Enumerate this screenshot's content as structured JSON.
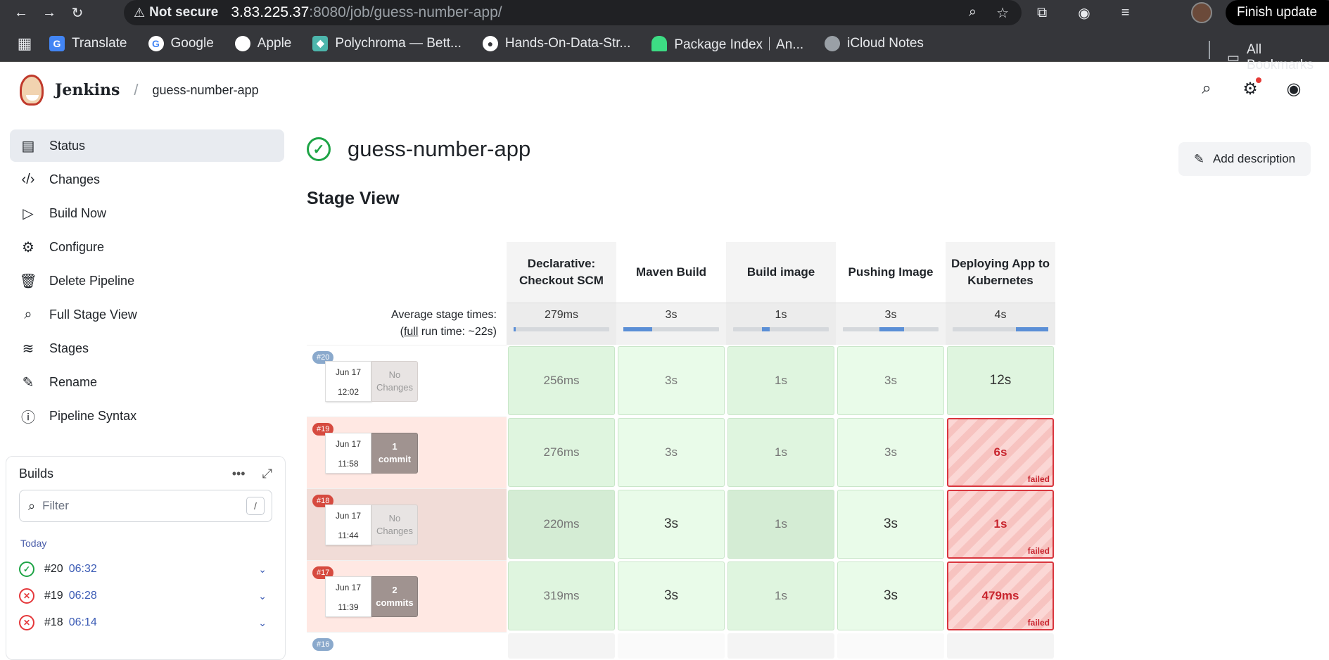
{
  "browser": {
    "security": "Not secure",
    "url_host": "3.83.225.37",
    "url_path": ":8080/job/guess-number-app/",
    "finish_update": "Finish update",
    "all_bookmarks": "All Bookmarks",
    "bookmarks": [
      {
        "label": "Translate",
        "color": "#4285f4"
      },
      {
        "label": "Google",
        "color": "#ffffff"
      },
      {
        "label": "Apple",
        "color": "#ffffff"
      },
      {
        "label": "Polychroma — Bett...",
        "color": "#4db6ac"
      },
      {
        "label": "Hands-On-Data-Str...",
        "color": "#ffffff"
      },
      {
        "label": "Package Index｜An...",
        "color": "#3ddc84"
      },
      {
        "label": "iCloud Notes",
        "color": "#9aa0a6"
      }
    ]
  },
  "header": {
    "app": "Jenkins",
    "breadcrumb": "guess-number-app"
  },
  "sidebar": {
    "items": [
      {
        "label": "Status",
        "icon": "document-icon"
      },
      {
        "label": "Changes",
        "icon": "code-icon"
      },
      {
        "label": "Build Now",
        "icon": "play-icon"
      },
      {
        "label": "Configure",
        "icon": "gear-icon"
      },
      {
        "label": "Delete Pipeline",
        "icon": "trash-icon"
      },
      {
        "label": "Full Stage View",
        "icon": "search-icon"
      },
      {
        "label": "Stages",
        "icon": "layers-icon"
      },
      {
        "label": "Rename",
        "icon": "pencil-icon"
      },
      {
        "label": "Pipeline Syntax",
        "icon": "help-icon"
      }
    ]
  },
  "builds": {
    "title": "Builds",
    "filter_placeholder": "Filter",
    "filter_shortcut": "/",
    "group": "Today",
    "rows": [
      {
        "num": "#20",
        "time": "06:32",
        "status": "success"
      },
      {
        "num": "#19",
        "time": "06:28",
        "status": "failed"
      },
      {
        "num": "#18",
        "time": "06:14",
        "status": "failed"
      }
    ]
  },
  "main": {
    "title": "guess-number-app",
    "add_description": "Add description",
    "stage_view_title": "Stage View"
  },
  "stage_view": {
    "stages": [
      "Declarative: Checkout SCM",
      "Maven Build",
      "Build image",
      "Pushing Image",
      "Deploying App to Kubernetes"
    ],
    "avg_label_1": "Average stage times:",
    "avg_label_2_pre": "(",
    "avg_label_2_link": "full",
    "avg_label_2_post": " run time: ~22s)",
    "avg_times": [
      "279ms",
      "3s",
      "1s",
      "3s",
      "4s"
    ],
    "avg_fill": [
      0.02,
      0.3,
      0.08,
      0.26,
      0.34
    ],
    "avg_fill_start": [
      0.0,
      0.0,
      0.3,
      0.38,
      0.66
    ],
    "failed_label": "failed",
    "runs": [
      {
        "badge": "#20",
        "date": "Jun 17",
        "time": "12:02",
        "changes_1": "No",
        "changes_2": "Changes",
        "has_commits": false,
        "row_style": "ok",
        "cells": [
          "256ms",
          "3s",
          "1s",
          "3s",
          "12s"
        ],
        "fails": [
          false,
          false,
          false,
          false,
          false
        ]
      },
      {
        "badge": "#19",
        "date": "Jun 17",
        "time": "11:58",
        "changes_1": "1",
        "changes_2": "commit",
        "has_commits": true,
        "row_style": "bad",
        "cells": [
          "276ms",
          "3s",
          "1s",
          "3s",
          "6s"
        ],
        "fails": [
          false,
          false,
          false,
          false,
          true
        ]
      },
      {
        "badge": "#18",
        "date": "Jun 17",
        "time": "11:44",
        "changes_1": "No",
        "changes_2": "Changes",
        "has_commits": false,
        "row_style": "bad2",
        "cells": [
          "220ms",
          "3s",
          "1s",
          "3s",
          "1s"
        ],
        "fails": [
          false,
          false,
          false,
          false,
          true
        ]
      },
      {
        "badge": "#17",
        "date": "Jun 17",
        "time": "11:39",
        "changes_1": "2",
        "changes_2": "commits",
        "has_commits": true,
        "row_style": "bad",
        "cells": [
          "319ms",
          "3s",
          "1s",
          "3s",
          "479ms"
        ],
        "fails": [
          false,
          false,
          false,
          false,
          true
        ]
      },
      {
        "badge": "#16",
        "partial": true
      }
    ]
  }
}
